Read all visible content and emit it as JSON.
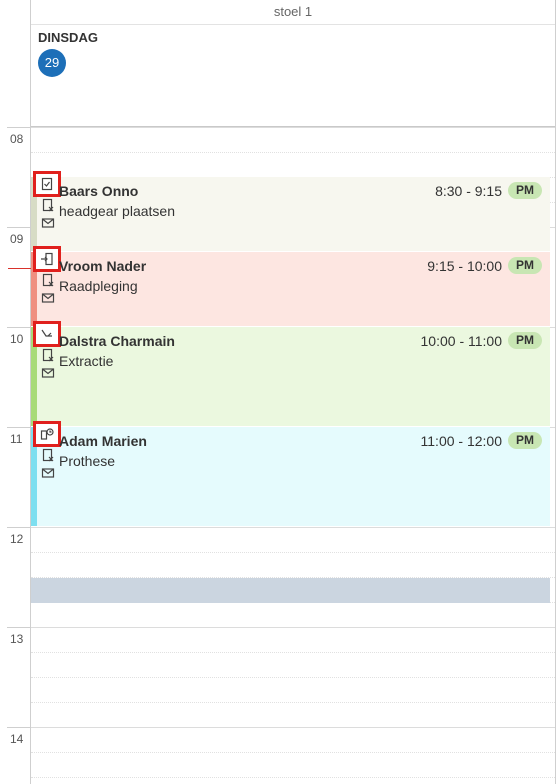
{
  "column": {
    "title": "stoel 1"
  },
  "day": {
    "name": "DINSDAG",
    "number": "29"
  },
  "hours": [
    "08",
    "09",
    "10",
    "11",
    "12",
    "13",
    "14"
  ],
  "appointments": [
    {
      "name": "Baars Onno",
      "description": "headgear plaatsen",
      "time": "8:30 - 9:15",
      "period": "PM",
      "status_icon": "clipboard-check-icon",
      "bg": "#f7f7ef",
      "stripe": "#d7dcc5"
    },
    {
      "name": "Vroom Nader",
      "description": "Raadpleging",
      "time": "9:15 - 10:00",
      "period": "PM",
      "status_icon": "enter-door-icon",
      "bg": "#fde6e1",
      "stripe": "#ef8f80"
    },
    {
      "name": "Dalstra Charmain",
      "description": "Extractie",
      "time": "10:00 - 11:00",
      "period": "PM",
      "status_icon": "dental-chair-icon",
      "bg": "#ebf8df",
      "stripe": "#a8db78"
    },
    {
      "name": "Adam Marien",
      "description": "Prothese",
      "time": "11:00 - 12:00",
      "period": "PM",
      "status_icon": "waiting-clock-icon",
      "bg": "#e5fbfd",
      "stripe": "#7ddff0"
    }
  ],
  "colors": {
    "accent": "#1d6fb8",
    "highlight_border": "#e0201d",
    "pm_badge": "#c8e6b3",
    "blocked": "#cbd5e0",
    "now_line": "#d9322b"
  }
}
